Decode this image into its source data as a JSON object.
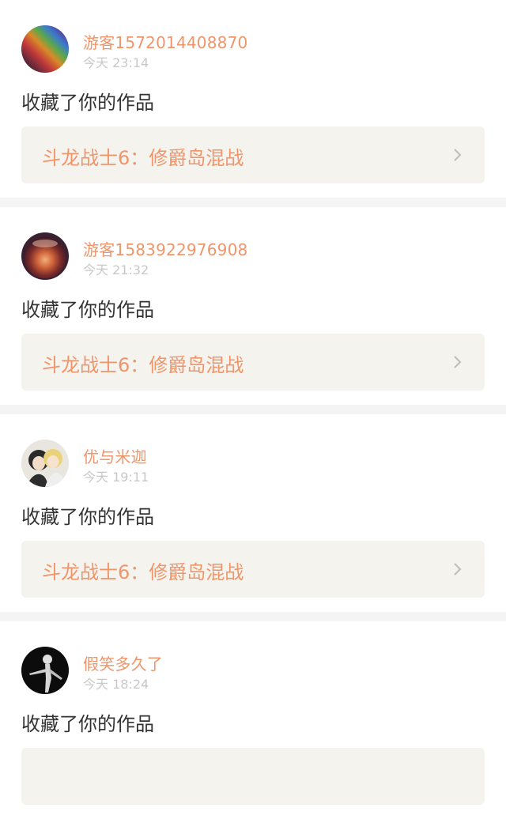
{
  "feed": {
    "items": [
      {
        "username": "游客1572014408870",
        "time": "今天 23:14",
        "action": "收藏了你的作品",
        "work_title": "斗龙战士6：修爵岛混战",
        "avatar": "rainbow-gradient-avatar"
      },
      {
        "username": "游客1583922976908",
        "time": "今天 21:32",
        "action": "收藏了你的作品",
        "work_title": "斗龙战士6：修爵岛混战",
        "avatar": "glowing-orb-avatar"
      },
      {
        "username": "优与米迦",
        "time": "今天 19:11",
        "action": "收藏了你的作品",
        "work_title": "斗龙战士6：修爵岛混战",
        "avatar": "anime-characters-avatar"
      },
      {
        "username": "假笑多久了",
        "time": "今天 18:24",
        "action": "收藏了你的作品",
        "work_title": "",
        "avatar": "dark-silhouette-avatar"
      }
    ]
  },
  "icons": {
    "chevron": "chevron-right-icon"
  },
  "colors": {
    "accent": "#f0956a",
    "card_bg": "#ffffff",
    "link_bg": "#f5f3ee",
    "page_bg": "#f4f4f4",
    "muted": "#c8c8c8",
    "text": "#333333"
  }
}
